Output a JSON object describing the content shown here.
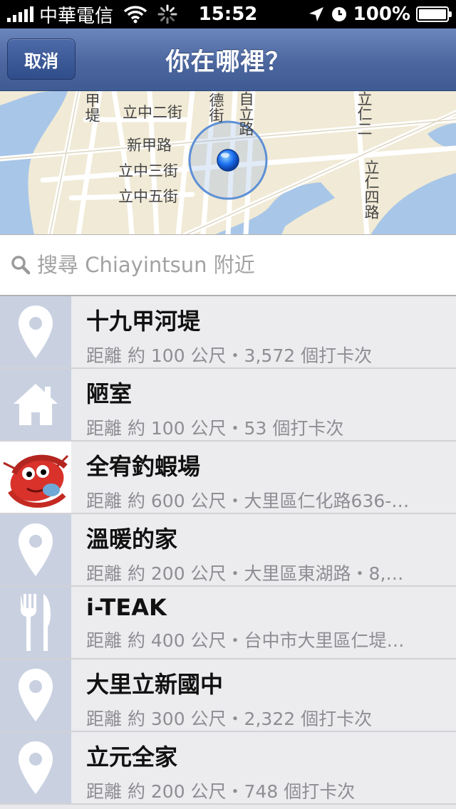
{
  "status_bar": {
    "carrier": "中華電信",
    "time": "15:52",
    "battery": "100%",
    "icons": [
      "signal-icon",
      "wifi-icon",
      "activity-spinner-icon",
      "location-arrow-icon",
      "alarm-clock-icon",
      "battery-charging-icon"
    ]
  },
  "nav": {
    "title": "你在哪裡？",
    "cancel_label": "取消"
  },
  "map": {
    "labels": [
      "甲堤",
      "立中二街",
      "新甲路",
      "立中三街",
      "立中五街",
      "自立路",
      "德街",
      "立仁二",
      "立仁四路"
    ]
  },
  "search": {
    "placeholder": "搜尋 Chiayintsun 附近"
  },
  "places": [
    {
      "name": "十九甲河堤",
      "detail": "距離 約 100 公尺・3,572 個打卡次",
      "icon": "map-pin-icon"
    },
    {
      "name": "陋室",
      "detail": "距離 約 100 公尺・53 個打卡次",
      "icon": "home-icon"
    },
    {
      "name": "全宥釣蝦場",
      "detail": "距離 約 600 公尺・大里區仁化路636-…",
      "icon": "shrimp-photo"
    },
    {
      "name": "溫暖的家",
      "detail": "距離 約 200 公尺・大里區東湖路・8,…",
      "icon": "map-pin-icon"
    },
    {
      "name": "i-TEAK",
      "detail": "距離 約 400 公尺・台中市大里區仁堤…",
      "icon": "fork-knife-icon"
    },
    {
      "name": "大里立新國中",
      "detail": "距離 約 300 公尺・2,322 個打卡次",
      "icon": "map-pin-icon"
    },
    {
      "name": "立元全家",
      "detail": "距離 約 200 公尺・748 個打卡次",
      "icon": "map-pin-icon"
    }
  ],
  "colors": {
    "nav_bar": "#4c679f",
    "thumb_bg": "#c9d1e1",
    "list_bg": "#ececef",
    "map_land": "#f0ead6",
    "map_water": "#a8c6e8",
    "location_dot": "#1a6ff0"
  }
}
